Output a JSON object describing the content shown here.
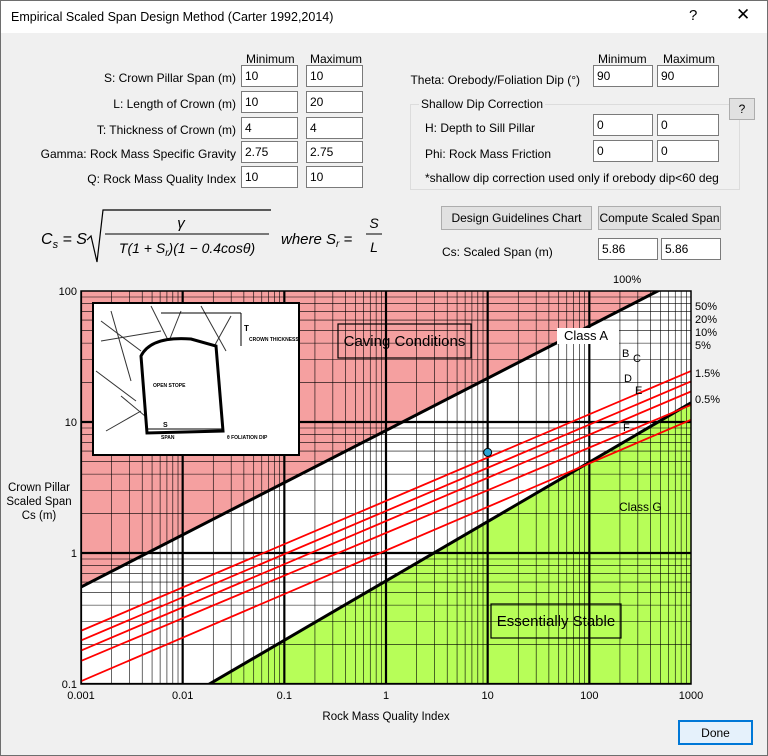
{
  "window": {
    "title": "Empirical Scaled Span Design Method (Carter 1992,2014)",
    "help": "?",
    "close": "✕"
  },
  "inputs": {
    "header_min": "Minimum",
    "header_max": "Maximum",
    "rows": [
      {
        "label": "S: Crown Pillar Span (m)",
        "min": "10",
        "max": "10"
      },
      {
        "label": "L: Length of Crown (m)",
        "min": "10",
        "max": "20"
      },
      {
        "label": "T: Thickness of Crown (m)",
        "min": "4",
        "max": "4"
      },
      {
        "label": "Gamma: Rock Mass Specific Gravity",
        "min": "2.75",
        "max": "2.75"
      },
      {
        "label": "Q: Rock Mass Quality Index",
        "min": "10",
        "max": "10"
      }
    ]
  },
  "theta": {
    "header_min": "Minimum",
    "header_max": "Maximum",
    "label": "Theta: Orebody/Foliation Dip (°)",
    "min": "90",
    "max": "90"
  },
  "shallow": {
    "title": "Shallow Dip Correction",
    "help": "?",
    "h_label": "H: Depth to Sill Pillar",
    "h_min": "0",
    "h_max": "0",
    "phi_label": "Phi: Rock Mass Friction",
    "phi_min": "0",
    "phi_max": "0",
    "note": "*shallow dip correction used only if orebody dip<60 deg"
  },
  "buttons": {
    "guidelines": "Design Guidelines Chart",
    "compute": "Compute Scaled Span",
    "done": "Done"
  },
  "result": {
    "label": "Cs: Scaled Span (m)",
    "min": "5.86",
    "max": "5.86"
  },
  "chart_data": {
    "type": "line",
    "x_scale": "log",
    "y_scale": "log",
    "xlim": [
      0.001,
      1000
    ],
    "ylim": [
      0.1,
      100
    ],
    "xlabel": "Rock Mass Quality Index",
    "ylabel": [
      "Crown Pillar",
      "Scaled Span",
      "Cs (m)"
    ],
    "x_ticks": [
      "0.001",
      "0.01",
      "0.1",
      "1",
      "10",
      "100",
      "1000"
    ],
    "y_ticks": [
      "100",
      "10",
      "1",
      "0.1"
    ],
    "grid": true,
    "regions": [
      "Caving Conditions",
      "Essentially Stable"
    ],
    "class_labels": [
      "Class A",
      "B",
      "C",
      "D",
      "E",
      "F",
      "Class G"
    ],
    "percent_labels": [
      "100%",
      "50%",
      "20%",
      "10%",
      "5%",
      "1.5%",
      "0.5%"
    ],
    "bounds": [
      {
        "name": "upper",
        "x": [
          0.001,
          1000
        ],
        "y": [
          0.55,
          135
        ]
      },
      {
        "name": "lower",
        "x": [
          0.01,
          1000
        ],
        "y": [
          0.076,
          14
        ]
      }
    ],
    "red_lines": [
      {
        "x": [
          0.001,
          1000
        ],
        "y": [
          0.255,
          24.5
        ]
      },
      {
        "x": [
          0.001,
          1000
        ],
        "y": [
          0.215,
          20.4
        ]
      },
      {
        "x": [
          0.001,
          1000
        ],
        "y": [
          0.18,
          17.1
        ]
      },
      {
        "x": [
          0.001,
          1000
        ],
        "y": [
          0.15,
          13.5
        ]
      },
      {
        "x": [
          0.001,
          1000
        ],
        "y": [
          0.105,
          10.4
        ]
      }
    ],
    "point": {
      "x": 10,
      "y": 5.86
    },
    "inset": {
      "labels": [
        "T",
        "CROWN THICKNESS",
        "OPEN STOPE",
        "S",
        "SPAN",
        "θ FOLIATION DIP"
      ]
    }
  }
}
